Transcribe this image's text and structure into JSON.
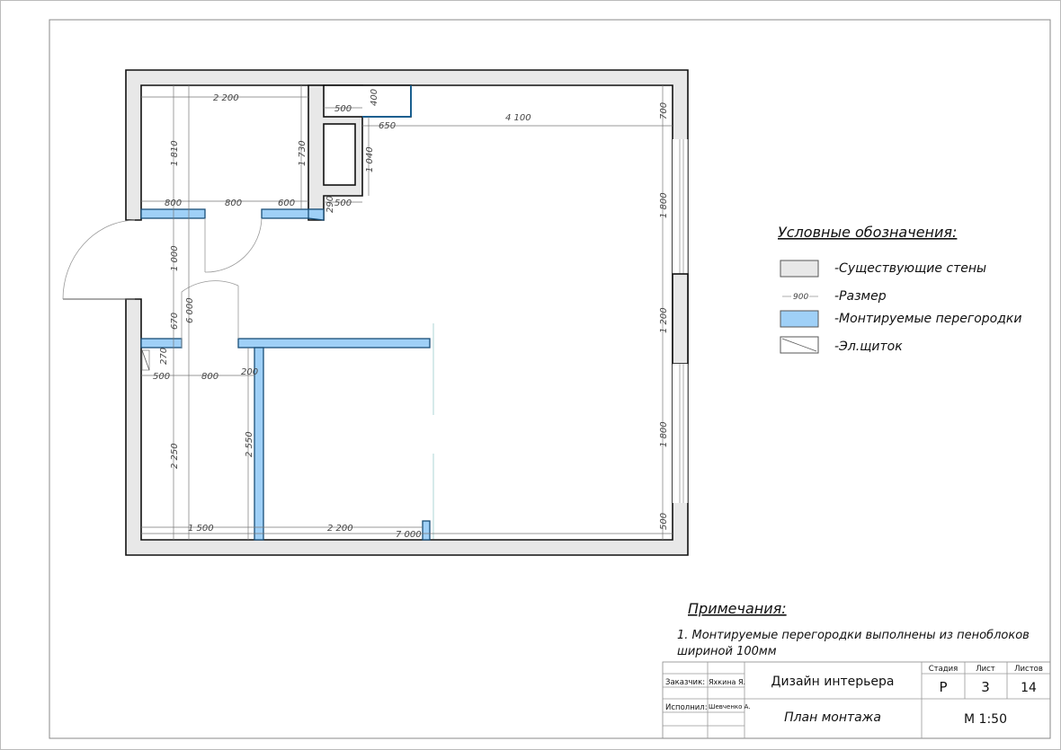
{
  "plan": {
    "dims": [
      "2 200",
      "1 810",
      "1 730",
      "500",
      "400",
      "650",
      "4 100",
      "700",
      "1 040",
      "500",
      "290",
      "800",
      "800",
      "600",
      "1 000",
      "670",
      "6 000",
      "270",
      "500",
      "800",
      "200",
      "2 250",
      "2 550",
      "1 500",
      "2 200",
      "7 000",
      "1 800",
      "1 200",
      "1 800",
      "500"
    ]
  },
  "legend": {
    "title": "Условные обозначения:",
    "items": [
      {
        "label": "-Существующие стены",
        "color": "#e8e8e8"
      },
      {
        "label": "-Размер",
        "sample": "900"
      },
      {
        "label": "-Монтируемые перегородки",
        "color": "#9fd0f7"
      },
      {
        "label": "-Эл.щиток"
      }
    ]
  },
  "notes": {
    "title": "Примечания:",
    "line1": "1. Монтируемые перегородки выполнены из пеноблоков",
    "line2": "шириной 100мм"
  },
  "title_block": {
    "customer_label": "Заказчик:",
    "customer": "Яхкина Я.",
    "author_label": "Исполнил:",
    "author": "Шевченко А.",
    "project": "Дизайн интерьера",
    "sheet_title": "План монтажа",
    "stage_label": "Стадия",
    "sheet_label": "Лист",
    "sheets_label": "Листов",
    "stage": "Р",
    "sheet": "3",
    "sheets": "14",
    "scale": "М 1:50"
  }
}
